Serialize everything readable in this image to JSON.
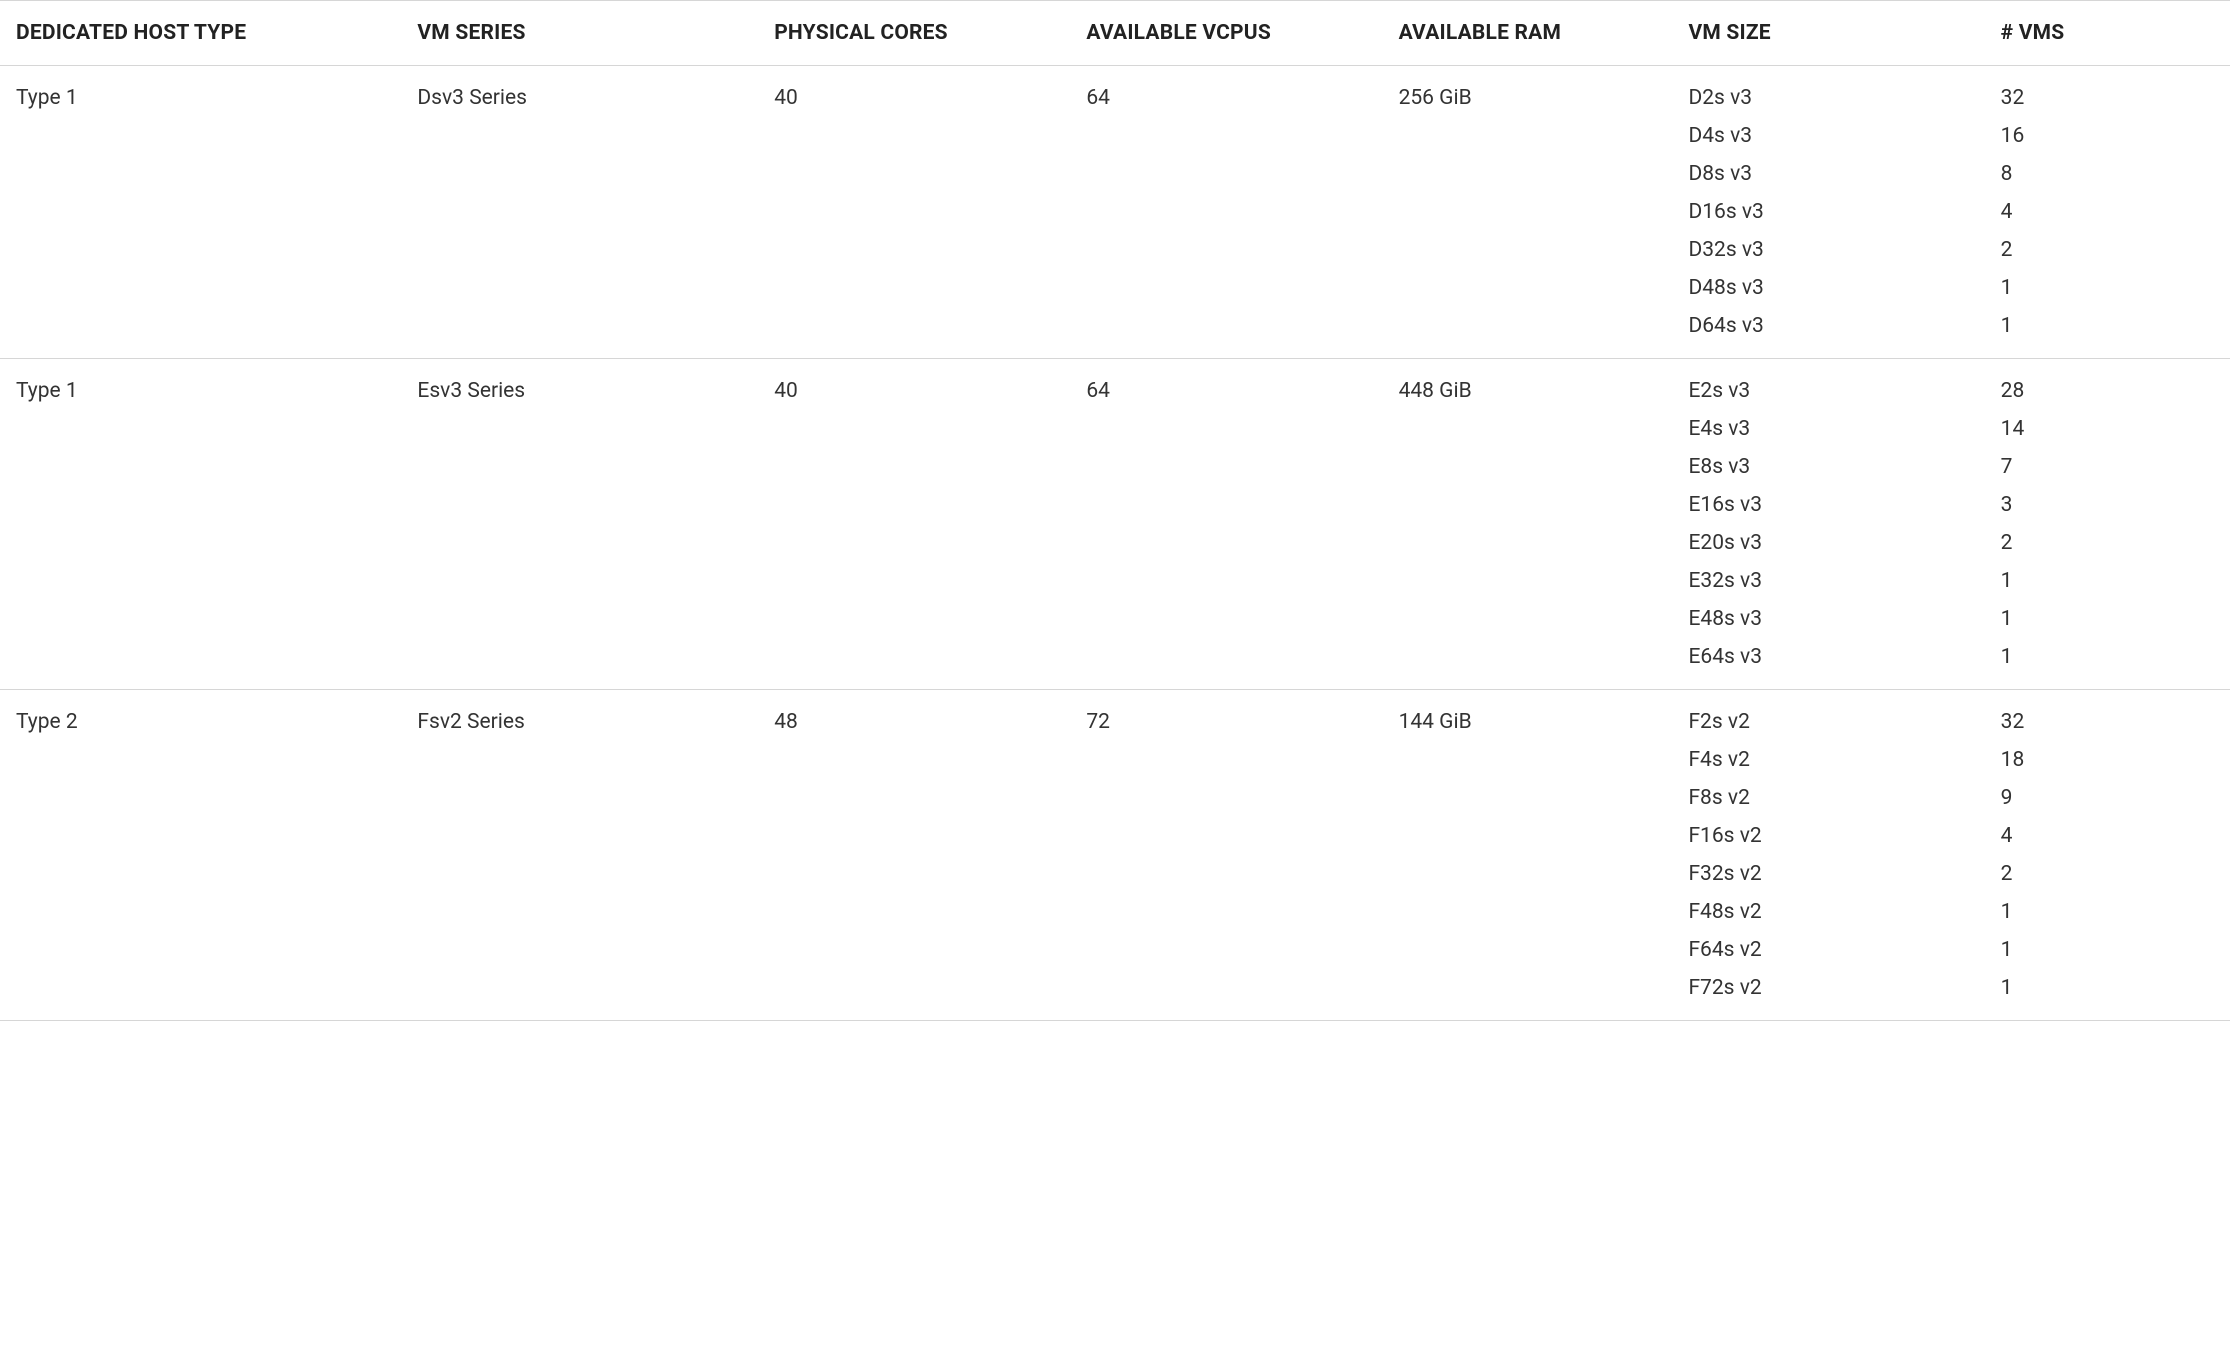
{
  "headers": {
    "host_type": "Dedicated Host Type",
    "vm_series": "VM Series",
    "physical_cores": "Physical Cores",
    "available_vcpus": "Available vCPUs",
    "available_ram": "Available RAM",
    "vm_size": "VM size",
    "num_vms": "# VMs"
  },
  "rows": [
    {
      "host_type": "Type 1",
      "vm_series": "Dsv3 Series",
      "physical_cores": "40",
      "available_vcpus": "64",
      "available_ram": "256 GiB",
      "sizes": [
        {
          "vm_size": "D2s v3",
          "num_vms": "32"
        },
        {
          "vm_size": "D4s v3",
          "num_vms": "16"
        },
        {
          "vm_size": "D8s v3",
          "num_vms": "8"
        },
        {
          "vm_size": "D16s v3",
          "num_vms": "4"
        },
        {
          "vm_size": "D32s v3",
          "num_vms": "2"
        },
        {
          "vm_size": "D48s v3",
          "num_vms": "1"
        },
        {
          "vm_size": "D64s v3",
          "num_vms": "1"
        }
      ]
    },
    {
      "host_type": "Type 1",
      "vm_series": "Esv3 Series",
      "physical_cores": "40",
      "available_vcpus": "64",
      "available_ram": "448 GiB",
      "sizes": [
        {
          "vm_size": "E2s v3",
          "num_vms": "28"
        },
        {
          "vm_size": "E4s v3",
          "num_vms": "14"
        },
        {
          "vm_size": "E8s v3",
          "num_vms": "7"
        },
        {
          "vm_size": "E16s v3",
          "num_vms": "3"
        },
        {
          "vm_size": "E20s v3",
          "num_vms": "2"
        },
        {
          "vm_size": "E32s v3",
          "num_vms": "1"
        },
        {
          "vm_size": "E48s v3",
          "num_vms": "1"
        },
        {
          "vm_size": "E64s v3",
          "num_vms": "1"
        }
      ]
    },
    {
      "host_type": "Type 2",
      "vm_series": "Fsv2 Series",
      "physical_cores": "48",
      "available_vcpus": "72",
      "available_ram": "144 GiB",
      "sizes": [
        {
          "vm_size": "F2s v2",
          "num_vms": "32"
        },
        {
          "vm_size": "F4s v2",
          "num_vms": "18"
        },
        {
          "vm_size": "F8s v2",
          "num_vms": "9"
        },
        {
          "vm_size": "F16s v2",
          "num_vms": "4"
        },
        {
          "vm_size": "F32s v2",
          "num_vms": "2"
        },
        {
          "vm_size": "F48s v2",
          "num_vms": "1"
        },
        {
          "vm_size": "F64s v2",
          "num_vms": "1"
        },
        {
          "vm_size": "F72s v2",
          "num_vms": "1"
        }
      ]
    }
  ]
}
